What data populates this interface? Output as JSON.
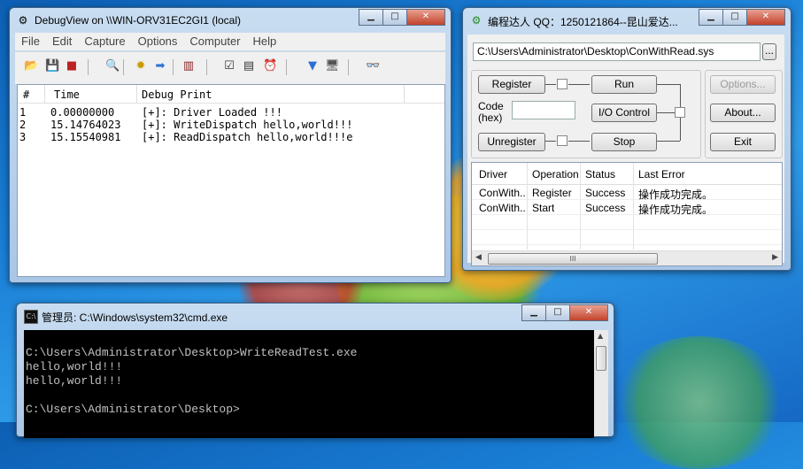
{
  "debugview": {
    "title": "DebugView on \\\\WIN-ORV31EC2GI1 (local)",
    "menu": [
      "File",
      "Edit",
      "Capture",
      "Options",
      "Computer",
      "Help"
    ],
    "columns": [
      "#",
      "Time",
      "Debug Print"
    ],
    "rows": [
      {
        "num": "1",
        "time": "0.00000000",
        "msg": "[+]: Driver Loaded !!!"
      },
      {
        "num": "2",
        "time": "15.14764023",
        "msg": "[+]: WriteDispatch hello,world!!!"
      },
      {
        "num": "3",
        "time": "15.15540981",
        "msg": "[+]: ReadDispatch hello,world!!!e"
      }
    ]
  },
  "loader": {
    "title": "编程达人 QQ：1250121864--昆山爱达...",
    "path": "C:\\Users\\Administrator\\Desktop\\ConWithRead.sys",
    "browse_label": "...",
    "code_label_1": "Code",
    "code_label_2": "(hex)",
    "code_value": "",
    "buttons": {
      "register": "Register",
      "run": "Run",
      "io_control": "I/O Control",
      "unregister": "Unregister",
      "stop": "Stop",
      "options": "Options...",
      "about": "About...",
      "exit": "Exit"
    },
    "grid_columns": [
      "Driver",
      "Operation",
      "Status",
      "Last Error"
    ],
    "grid_rows": [
      {
        "driver": "ConWith...",
        "operation": "Register",
        "status": "Success",
        "error": "操作成功完成。"
      },
      {
        "driver": "ConWith...",
        "operation": "Start",
        "status": "Success",
        "error": "操作成功完成。"
      }
    ],
    "scroll_grip": "III"
  },
  "cmd": {
    "title": "管理员: C:\\Windows\\system32\\cmd.exe",
    "lines": [
      "",
      "C:\\Users\\Administrator\\Desktop>WriteReadTest.exe",
      "hello,world!!!",
      "hello,world!!!",
      "",
      "C:\\Users\\Administrator\\Desktop>"
    ]
  },
  "window_buttons": {
    "minimize": "▁",
    "maximize": "□",
    "close": "✕"
  }
}
